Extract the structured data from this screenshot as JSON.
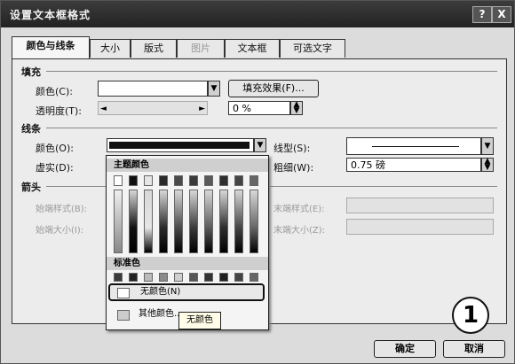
{
  "window": {
    "title": "设置文本框格式",
    "help": "?",
    "close": "X"
  },
  "tabs": [
    {
      "label": "颜色与线条"
    },
    {
      "label": "大小"
    },
    {
      "label": "版式"
    },
    {
      "label": "图片"
    },
    {
      "label": "文本框"
    },
    {
      "label": "可选文字"
    }
  ],
  "fill": {
    "section": "填充",
    "color_label": "颜色(C):",
    "color_value": "",
    "effects_button": "填充效果(F)...",
    "transparency_label": "透明度(T):",
    "transparency_value": "0 %"
  },
  "line": {
    "section": "线条",
    "color_label": "颜色(O):",
    "dash_label": "虚实(D):",
    "style_label": "线型(S):",
    "weight_label": "粗细(W):",
    "weight_value": "0.75 磅"
  },
  "arrows": {
    "section": "箭头",
    "begin_style_label": "始端样式(B):",
    "begin_size_label": "始端大小(I):",
    "end_style_label": "末端样式(E):",
    "end_size_label": "末端大小(Z):"
  },
  "color_popup": {
    "theme_header": "主题颜色",
    "standard_header": "标准色",
    "no_color": "无颜色(N)",
    "more_colors": "其他颜色...",
    "tooltip": "无颜色",
    "theme_top": [
      "#ffffff",
      "#111111",
      "#e6e6e6",
      "#2a2a2a",
      "#4a4a4a",
      "#3a3a3a",
      "#5a5a5a",
      "#2e2e2e",
      "#444444",
      "#666666"
    ],
    "standard": [
      "#3a3a3a",
      "#222222",
      "#bbbbbb",
      "#8a8a8a",
      "#cfcfcf",
      "#555555",
      "#333333",
      "#1e1e1e",
      "#444444",
      "#666666"
    ]
  },
  "buttons": {
    "ok": "确定",
    "cancel": "取消"
  },
  "marker": "1"
}
